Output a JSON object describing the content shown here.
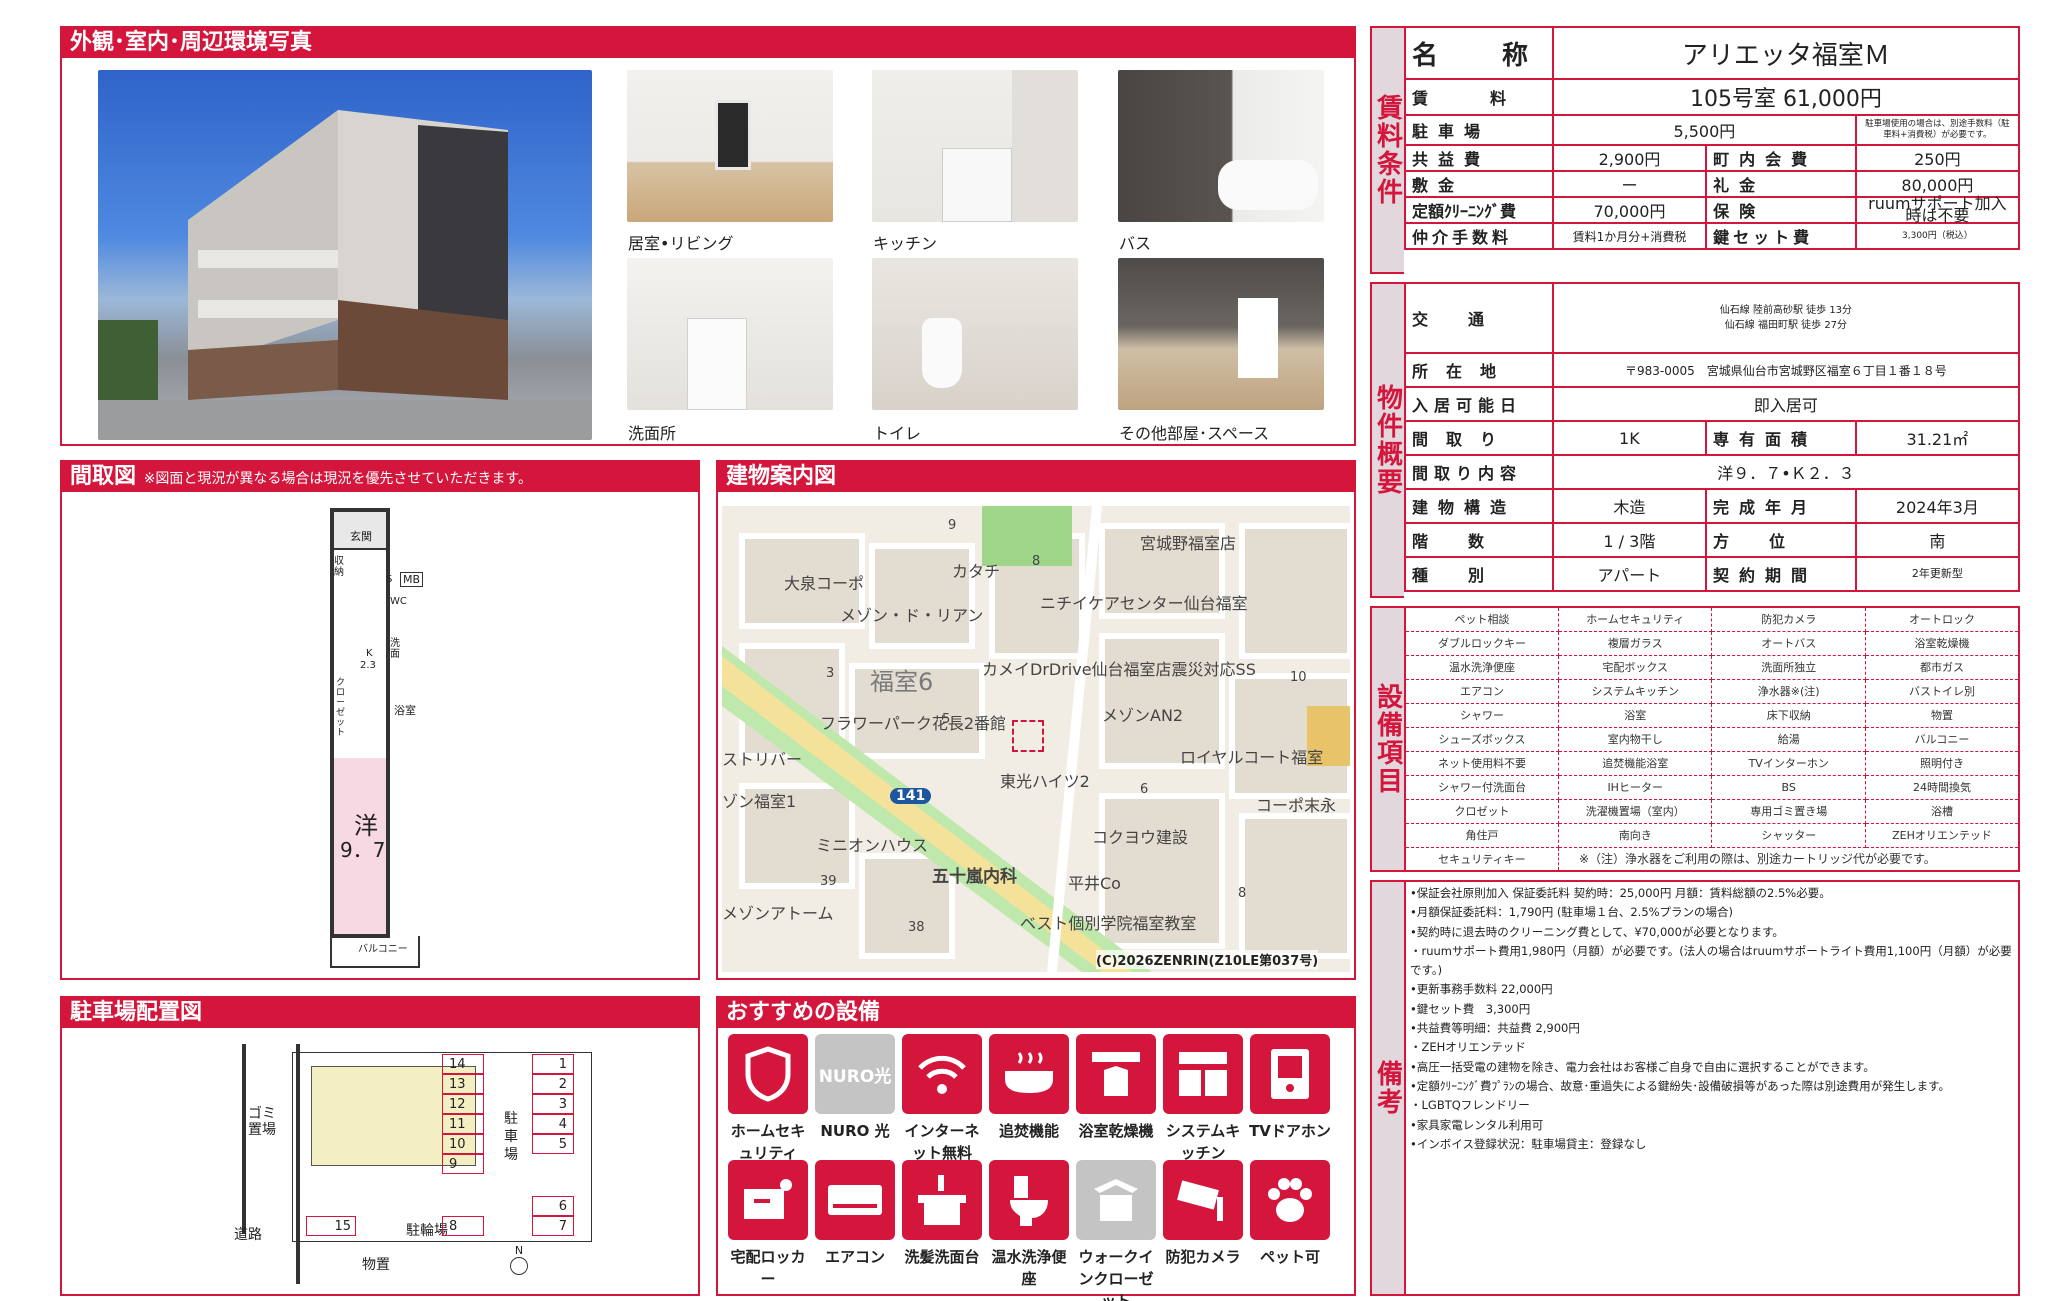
{
  "photos": {
    "title": "外観･室内･周辺環境写真",
    "captions": [
      "居室•リビング",
      "キッチン",
      "バス",
      "洗面所",
      "トイレ",
      "その他部屋･スペース"
    ]
  },
  "floor": {
    "title": "間取図",
    "note": "※図面と現況が異なる場合は現況を優先させていただきます。",
    "labels": {
      "genkan": "玄関",
      "shuno": "収納",
      "s": "S",
      "mb": "MB",
      "wc": "WC",
      "senmen": "洗面",
      "k": "K",
      "k23": "2.3",
      "closet": "クローゼット",
      "yokushitsu": "浴室",
      "you": "洋",
      "you_size": "9．7",
      "balcony": "バルコニー"
    }
  },
  "map": {
    "title": "建物案内図",
    "labels": [
      "宮城野福室店",
      "大泉コーポ",
      "カタチ",
      "ニチイケアセンター仙台福室",
      "メゾン・ド・リアン",
      "福室6",
      "カメイDrDrive仙台福室店震災対応SS",
      "メゾンAN2",
      "フラワーパーク花長2番館",
      "ロイヤルコート福室",
      "ストリバー",
      "東光ハイツ2",
      "ゾン福室1",
      "コーポ末永",
      "ミニオンハウス",
      "コクヨウ建設",
      "五十嵐内科",
      "平井Co",
      "メゾンアトーム",
      "ベスト個別学院福室教室",
      "141",
      "(C)2026ZENRIN(Z10LE第037号)"
    ],
    "numbers": [
      "9",
      "8",
      "3",
      "10",
      "6",
      "5",
      "39",
      "38",
      "8"
    ]
  },
  "parking": {
    "title": "駐車場配置図",
    "left_slots": [
      "14",
      "13",
      "12",
      "11",
      "10",
      "9"
    ],
    "right_slots": [
      "1",
      "2",
      "3",
      "4",
      "5"
    ],
    "right_slots2": [
      "6",
      "7"
    ],
    "bottom_slots": [
      "15",
      "8"
    ],
    "labels": {
      "gomi": "ゴミ置場",
      "chusha": "駐車場",
      "doro": "道路",
      "bushiki": "物置",
      "chirin": "駐輪場",
      "north": "N"
    }
  },
  "equipment_icons": {
    "title": "おすすめの設備",
    "items": [
      {
        "label": "ホームセキュリティ",
        "icon": "shield-icon"
      },
      {
        "label": "NURO 光",
        "icon": "nuro-icon",
        "badge": "NURO光"
      },
      {
        "label": "インターネット無料",
        "icon": "wifi-icon"
      },
      {
        "label": "追焚機能",
        "icon": "bath-icon"
      },
      {
        "label": "浴室乾燥機",
        "icon": "bath-dryer-icon"
      },
      {
        "label": "システムキッチン",
        "icon": "kitchen-icon"
      },
      {
        "label": "TVドアホン",
        "icon": "intercom-icon"
      },
      {
        "label": "宅配ロッカー",
        "icon": "locker-icon"
      },
      {
        "label": "エアコン",
        "icon": "aircon-icon"
      },
      {
        "label": "洗髪洗面台",
        "icon": "washbasin-icon"
      },
      {
        "label": "温水洗浄便座",
        "icon": "toilet-icon"
      },
      {
        "label": "ウォークインクローゼット",
        "icon": "closet-icon"
      },
      {
        "label": "防犯カメラ",
        "icon": "camera-icon"
      },
      {
        "label": "ペット可",
        "icon": "paw-icon"
      }
    ]
  },
  "rent": {
    "side": "賃料条件",
    "name_label": "名　　称",
    "name": "アリエッタ福室Ｍ",
    "rent_label": "賃　　料",
    "rent": "105号室 61,000円",
    "parking_label": "駐車場",
    "parking": "5,500円",
    "parking_note": "駐車場使用の場合は、別途手数料（駐車料+消費税）が必要です。",
    "kyoeki_label": "共益費",
    "kyoeki": "2,900円",
    "chonai_label": "町内会費",
    "chonai": "250円",
    "shiki_label": "敷金",
    "shiki": "ー",
    "rei_label": "礼金",
    "rei": "80,000円",
    "cleaning_label": "定額ｸﾘｰﾆﾝｸﾞ費",
    "cleaning": "70,000円",
    "hoken_label": "保険",
    "hoken": "ruumサポート加入時は不要",
    "chukai_label": "仲介手数料",
    "chukai": "賃料1か月分+消費税",
    "kagi_label": "鍵セット費",
    "kagi": "3,300円（税込）"
  },
  "property": {
    "side": "物件概要",
    "kotsu_label": "交通",
    "kotsu": [
      "仙石線 陸前高砂駅 徒歩 13分",
      "仙石線 福田町駅 徒歩 27分"
    ],
    "shozai_label": "所在地",
    "shozai": "〒983-0005　宮城県仙台市宮城野区福室６丁目１番１８号",
    "nyukyo_label": "入居可能日",
    "nyukyo": "即入居可",
    "madori_label": "間取り",
    "madori": "1K",
    "menseki_label": "専有面積",
    "menseki": "31.21㎡",
    "naiyo_label": "間取り内容",
    "naiyo": "洋９．７•Ｋ２．３",
    "kozo_label": "建物構造",
    "kozo": "木造",
    "kansei_label": "完成年月",
    "kansei": "2024年3月",
    "kaisu_label": "階数",
    "kaisu": "1 / 3階",
    "hoi_label": "方位",
    "hoi": "南",
    "shubetsu_label": "種別",
    "shubetsu": "アパート",
    "keiyaku_label": "契約期間",
    "keiyaku": "2年更新型"
  },
  "facilities": {
    "side": "設備項目",
    "rows": [
      [
        "ペット相談",
        "ホームセキュリティ",
        "防犯カメラ",
        "オートロック"
      ],
      [
        "ダブルロックキー",
        "複層ガラス",
        "オートバス",
        "浴室乾燥機"
      ],
      [
        "温水洗浄便座",
        "宅配ボックス",
        "洗面所独立",
        "都市ガス"
      ],
      [
        "エアコン",
        "システムキッチン",
        "浄水器※(注)",
        "バストイレ別"
      ],
      [
        "シャワー",
        "浴室",
        "床下収納",
        "物置"
      ],
      [
        "シューズボックス",
        "室内物干し",
        "給湯",
        "バルコニー"
      ],
      [
        "ネット使用料不要",
        "追焚機能浴室",
        "TVインターホン",
        "照明付き"
      ],
      [
        "シャワー付洗面台",
        "IHヒーター",
        "BS",
        "24時間換気"
      ],
      [
        "クロゼット",
        "洗濯機置場（室内）",
        "専用ゴミ置き場",
        "浴槽"
      ],
      [
        "角住戸",
        "南向き",
        "シャッター",
        "ZEHオリエンテッド"
      ]
    ],
    "last_row_first": "セキュリティキー",
    "note": "※（注）浄水器をご利用の際は、別途カートリッジ代が必要です。"
  },
  "remarks": {
    "side": "備考",
    "lines": [
      "•保証会社原則加入 保証委託料 契約時：25,000円 月額：賃料総額の2.5%必要。",
      "•月額保証委託料：1,790円 (駐車場１台、2.5%プランの場合)",
      "•契約時に退去時のクリーニング費として、¥70,000が必要となります。",
      "・ruumサポート費用1,980円（月額）が必要です。(法人の場合はruumサポートライト費用1,100円（月額）が必要です。)",
      "•更新事務手数料 22,000円",
      "•鍵セット費　3,300円",
      "•共益費等明細：共益費 2,900円",
      "・ZEHオリエンテッド",
      "•高圧一括受電の建物を除き、電力会社はお客様ご自身で自由に選択することができます。",
      "•定額ｸﾘｰﾆﾝｸﾞ費ﾌﾟﾗﾝの場合、故意･重過失による鍵紛失･設備破損等があった際は別途費用が発生します。",
      "・LGBTQフレンドリー",
      "•家具家電レンタル利用可",
      "•インボイス登録状況：駐車場貸主：登録なし"
    ]
  }
}
